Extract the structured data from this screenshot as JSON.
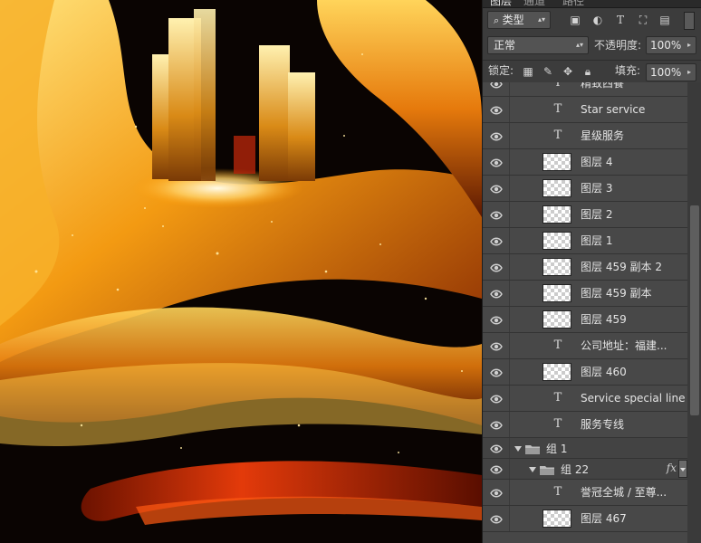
{
  "panel": {
    "tabs": [
      "图层",
      "通道",
      "路径"
    ],
    "filter": {
      "label": "类型",
      "icon": "search-icon"
    },
    "blend_mode": "正常",
    "opacity_label": "不透明度:",
    "opacity_value": "100%",
    "lock_label": "锁定:",
    "fill_label": "填充:",
    "fill_value": "100%"
  },
  "layers": [
    {
      "type": "text",
      "name": "精致西餐"
    },
    {
      "type": "text",
      "name": "Star service"
    },
    {
      "type": "text",
      "name": "星级服务"
    },
    {
      "type": "pixel",
      "name": "图层 4"
    },
    {
      "type": "pixel",
      "name": "图层 3"
    },
    {
      "type": "pixel",
      "name": "图层 2"
    },
    {
      "type": "pixel",
      "name": "图层 1"
    },
    {
      "type": "pixel",
      "name": "图层 459 副本 2"
    },
    {
      "type": "pixel",
      "name": "图层 459 副本"
    },
    {
      "type": "pixel",
      "name": "图层 459"
    },
    {
      "type": "text",
      "name": "公司地址：福建..."
    },
    {
      "type": "pixel",
      "name": "图层 460"
    },
    {
      "type": "text",
      "name": "Service special line"
    },
    {
      "type": "text",
      "name": "服务专线"
    },
    {
      "type": "group",
      "name": "组 1",
      "level": 0
    },
    {
      "type": "group",
      "name": "组 22",
      "level": 1,
      "fx": "fx"
    },
    {
      "type": "text",
      "name": "誉冠全城 / 至尊..."
    },
    {
      "type": "pixel",
      "name": "图层 467"
    }
  ],
  "colors": {
    "panel_bg": "#3c3c3c",
    "row_bg": "#484848",
    "canvas_gold": "#f5a21b",
    "canvas_dark": "#0a0402"
  }
}
